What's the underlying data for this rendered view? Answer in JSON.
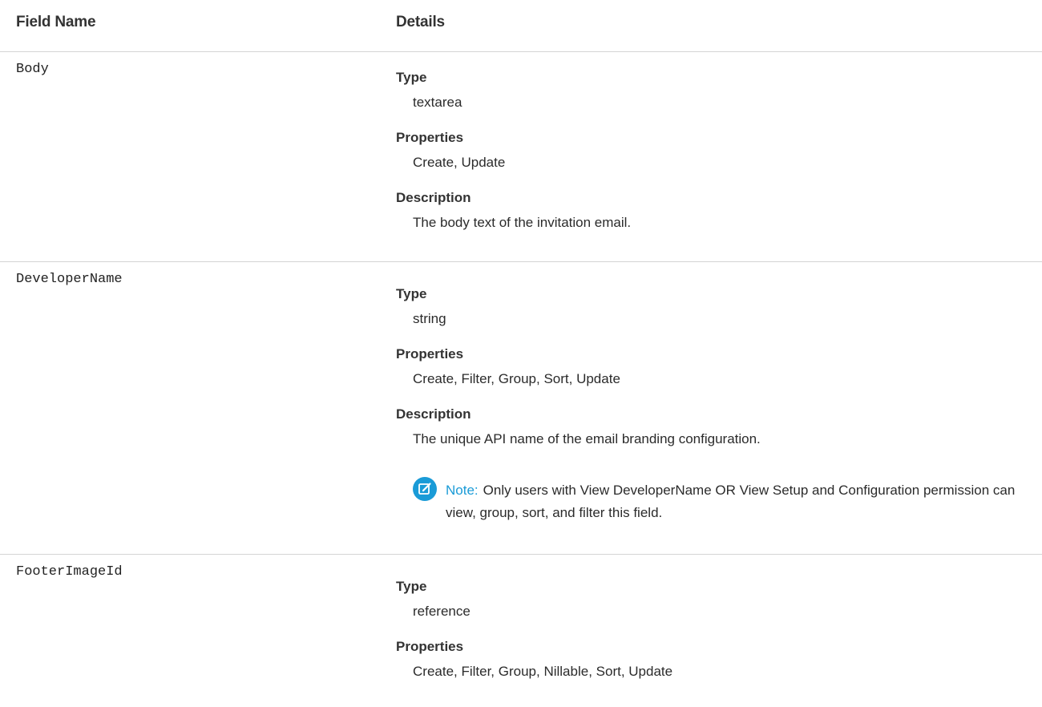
{
  "header": {
    "col1": "Field Name",
    "col2": "Details"
  },
  "labels": {
    "type": "Type",
    "properties": "Properties",
    "description": "Description"
  },
  "fields": [
    {
      "name": "Body",
      "type": "textarea",
      "properties": "Create, Update",
      "description": "The body text of the invitation email."
    },
    {
      "name": "DeveloperName",
      "type": "string",
      "properties": "Create, Filter, Group, Sort, Update",
      "description": "The unique API name of the email branding configuration.",
      "note": {
        "label": "Note:",
        "text": "Only users with View DeveloperName OR View Setup and Configuration permission can view, group, sort, and filter this field."
      }
    },
    {
      "name": "FooterImageId",
      "type": "reference",
      "properties": "Create, Filter, Group, Nillable, Sort, Update"
    }
  ],
  "colors": {
    "note_accent": "#1a9bd7",
    "divider": "#d4d4d4"
  },
  "icons": {
    "note": "note-edit-icon"
  }
}
